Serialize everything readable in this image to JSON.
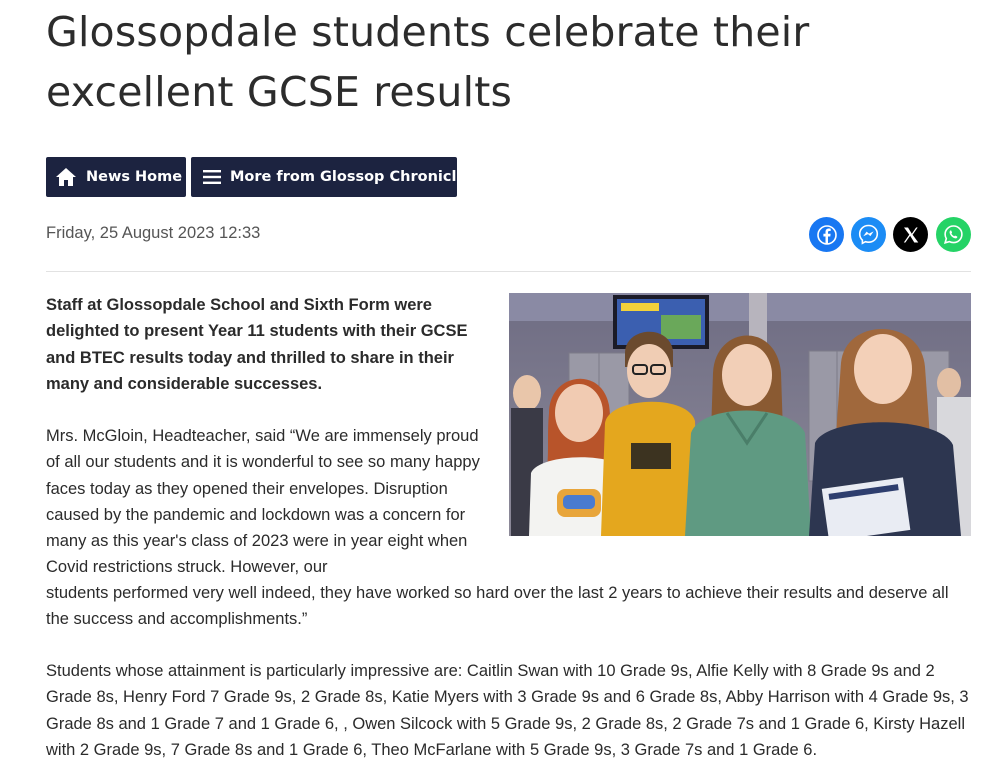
{
  "article": {
    "headline": "Glossopdale students celebrate their excellent GCSE results",
    "date": "Friday, 25 August 2023 12:33"
  },
  "nav": {
    "news_home_label": "News Home",
    "more_label": "More from Glossop Chronicle"
  },
  "share": {
    "icons": [
      "facebook-icon",
      "messenger-icon",
      "x-icon",
      "whatsapp-icon"
    ],
    "colors": {
      "facebook": "#1877f2",
      "messenger": "#1b8cf5",
      "x": "#000000",
      "whatsapp": "#25d366"
    }
  },
  "body": {
    "lead": "Staff at Glossopdale School and Sixth Form were delighted to present Year 11 students with their GCSE and BTEC results today and thrilled to share in their many and considerable successes.",
    "quote_part1": "Mrs. McGloin, Headteacher, said “We are immensely proud of all our students and it is wonderful to see so many happy faces today as they opened their envelopes. Disruption caused by the pandemic and lockdown was a concern for many as this year's class of 2023 were in year eight when Covid restrictions struck. However, our",
    "quote_part2": "students performed very well indeed, they have worked so hard over the last 2 years to achieve their results and deserve all the success and accomplishments.”",
    "students": "Students whose attainment is particularly impressive are: Caitlin Swan with 10 Grade 9s, Alfie Kelly with 8 Grade 9s and 2 Grade 8s, Henry Ford 7 Grade 9s, 2 Grade 8s,  Katie Myers with 3 Grade 9s and 6 Grade 8s, Abby Harrison  with 4 Grade 9s, 3 Grade 8s and 1 Grade 7 and 1 Grade 6, , Owen Silcock with 5 Grade 9s, 2 Grade 8s, 2 Grade 7s and 1 Grade 6, Kirsty Hazell with 2 Grade 9s, 7 Grade 8s and 1 Grade 6, Theo McFarlane with 5 Grade 9s, 3 Grade 7s and 1 Grade 6."
  },
  "colors": {
    "button_bg": "#1c2340",
    "text": "#2b2b2b",
    "date": "#555555"
  }
}
